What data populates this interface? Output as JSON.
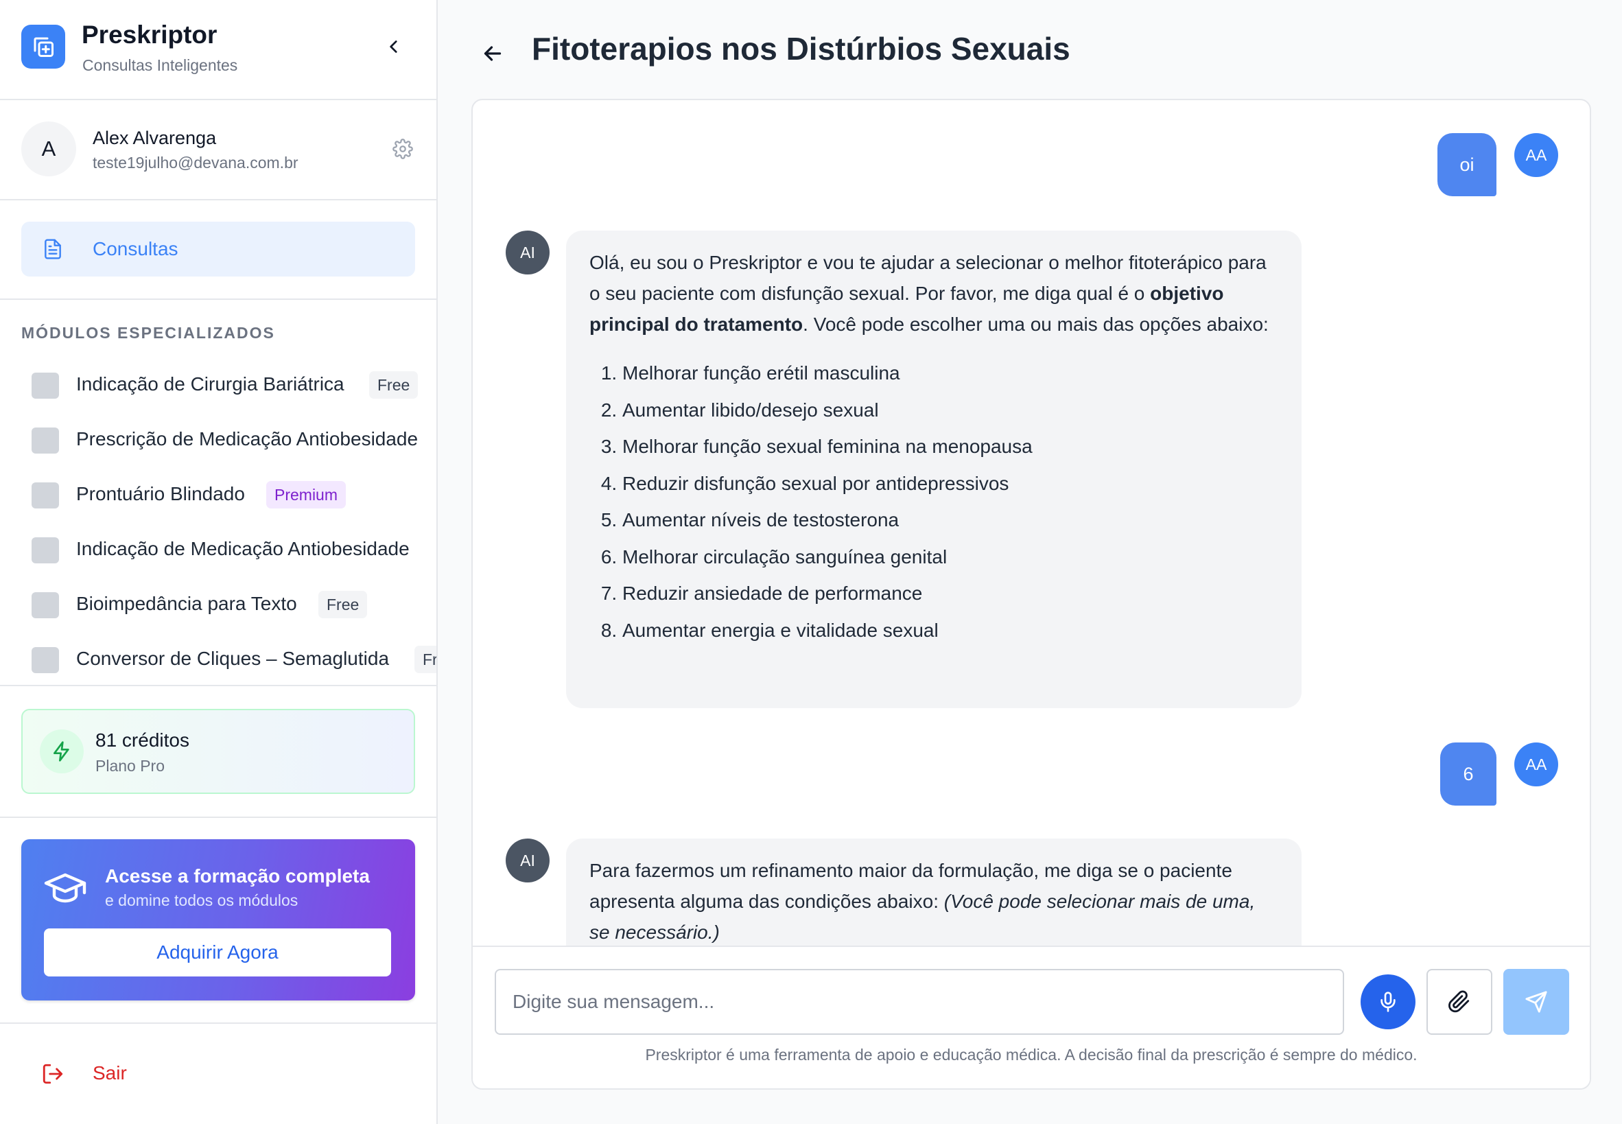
{
  "app": {
    "name": "Preskriptor",
    "subtitle": "Consultas Inteligentes"
  },
  "user": {
    "initial": "A",
    "name": "Alex Alvarenga",
    "email": "teste19julho@devana.com.br"
  },
  "nav": {
    "consultas": "Consultas"
  },
  "modules": {
    "title": "MÓDULOS ESPECIALIZADOS",
    "items": [
      {
        "name": "Indicação de Cirurgia Bariátrica",
        "badge": "Free"
      },
      {
        "name": "Prescrição de Medicação Antiobesidade",
        "badge": ""
      },
      {
        "name": "Prontuário Blindado",
        "badge": "Premium"
      },
      {
        "name": "Indicação de Medicação Antiobesidade",
        "badge": ""
      },
      {
        "name": "Bioimpedância para Texto",
        "badge": "Free"
      },
      {
        "name": "Conversor de Cliques – Semaglutida",
        "badge": "Fr"
      }
    ]
  },
  "credits": {
    "amount": "81 créditos",
    "plan": "Plano Pro"
  },
  "promo": {
    "title": "Acesse a formação completa",
    "subtitle": "e domine todos os módulos",
    "button": "Adquirir Agora"
  },
  "logout": "Sair",
  "page": {
    "title": "Fitoterapios nos Distúrbios Sexuais"
  },
  "chat": {
    "user_initials": "AA",
    "ai_label": "AI",
    "msg1": "oi",
    "msg2": {
      "intro_a": "Olá, eu sou o Preskriptor e vou te ajudar a selecionar o melhor fitoterápico para o seu paciente com disfunção sexual. Por favor, me diga qual é o ",
      "intro_bold": "objetivo principal do tratamento",
      "intro_b": ". Você pode escolher uma ou mais das opções abaixo:",
      "options": [
        "Melhorar função erétil masculina",
        "Aumentar libido/desejo sexual",
        "Melhorar função sexual feminina na menopausa",
        "Reduzir disfunção sexual por antidepressivos",
        "Aumentar níveis de testosterona",
        "Melhorar circulação sanguínea genital",
        "Reduzir ansiedade de performance",
        "Aumentar energia e vitalidade sexual"
      ]
    },
    "msg3": "6",
    "msg4": {
      "text": "Para fazermos um refinamento maior da formulação, me diga se o paciente apresenta alguma das condições abaixo: ",
      "italic": "(Você pode selecionar mais de uma, se necessário.)"
    }
  },
  "composer": {
    "placeholder": "Digite sua mensagem...",
    "disclaimer": "Preskriptor é uma ferramenta de apoio e educação médica. A decisão final da prescrição é sempre do médico."
  },
  "colors": {
    "primary": "#3b82f6",
    "user_bubble": "#4f86f0",
    "danger": "#dc2626",
    "premium": "#7e22ce"
  }
}
